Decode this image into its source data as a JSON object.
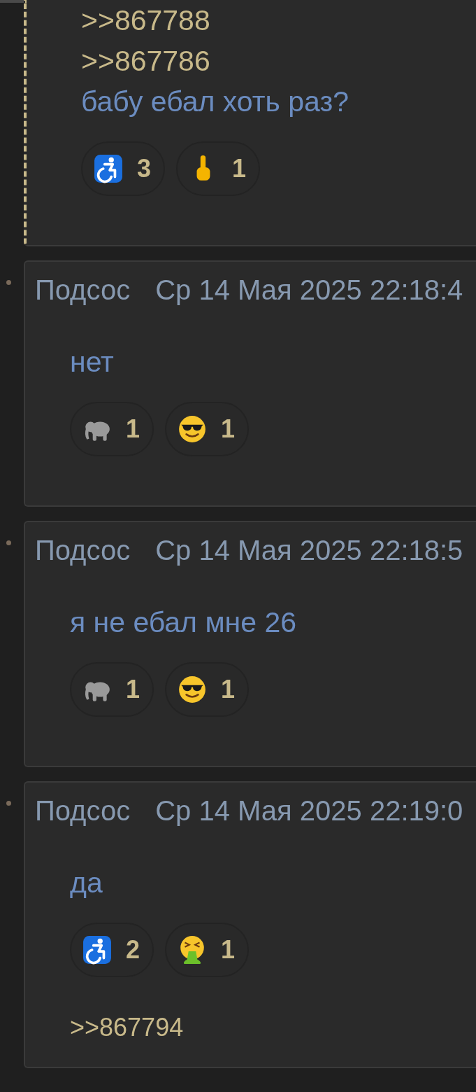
{
  "posts": [
    {
      "highlighted": true,
      "replies": [
        ">>867788",
        ">>867786"
      ],
      "text": "бабу ебал хоть раз?",
      "reactions": [
        {
          "kind": "wheelchair",
          "count": "3"
        },
        {
          "kind": "hand",
          "count": "1"
        }
      ]
    },
    {
      "highlighted": false,
      "author": "Подсос",
      "date": "Ср 14 Мая 2025 22:18:4",
      "text": "нет",
      "reactions": [
        {
          "kind": "elephant",
          "count": "1"
        },
        {
          "kind": "sunglasses",
          "count": "1"
        }
      ]
    },
    {
      "highlighted": false,
      "author": "Подсос",
      "date": "Ср 14 Мая 2025 22:18:5",
      "text": "я не ебал мне 26",
      "reactions": [
        {
          "kind": "elephant",
          "count": "1"
        },
        {
          "kind": "sunglasses",
          "count": "1"
        }
      ]
    },
    {
      "highlighted": false,
      "author": "Подсос",
      "date": "Ср 14 Мая 2025 22:19:0",
      "text": "да",
      "reactions": [
        {
          "kind": "wheelchair",
          "count": "2"
        },
        {
          "kind": "vomit",
          "count": "1"
        }
      ],
      "backlinks": [
        ">>867794"
      ]
    }
  ]
}
